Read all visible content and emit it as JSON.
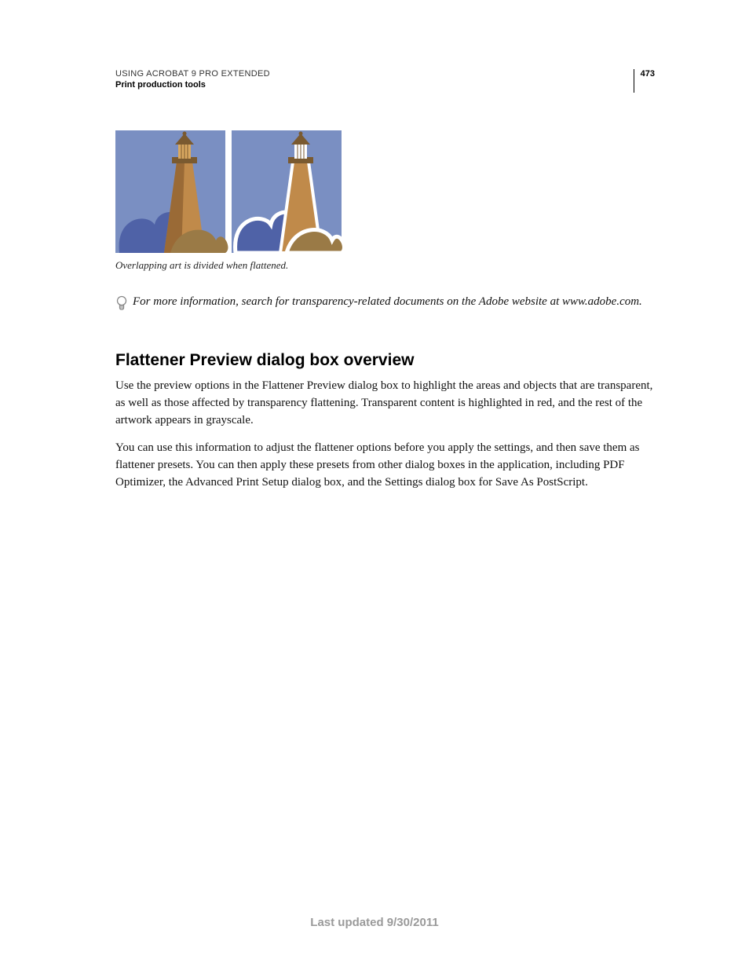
{
  "header": {
    "doc_title": "USING ACROBAT 9 PRO EXTENDED",
    "section": "Print production tools",
    "page_number": "473"
  },
  "figure": {
    "caption": "Overlapping art is divided when flattened."
  },
  "tip": {
    "text": "For more information, search for transparency-related documents on the Adobe website at www.adobe.com."
  },
  "content": {
    "heading": "Flattener Preview dialog box overview",
    "para1": "Use the preview options in the Flattener Preview dialog box to highlight the areas and objects that are transparent, as well as those affected by transparency flattening. Transparent content is highlighted in red, and the rest of the artwork appears in grayscale.",
    "para2": "You can use this information to adjust the flattener options before you apply the settings, and then save them as flattener presets. You can then apply these presets from other dialog boxes in the application, including PDF Optimizer, the Advanced Print Setup dialog box, and the Settings dialog box for Save As PostScript."
  },
  "footer": {
    "last_updated": "Last updated 9/30/2011"
  }
}
